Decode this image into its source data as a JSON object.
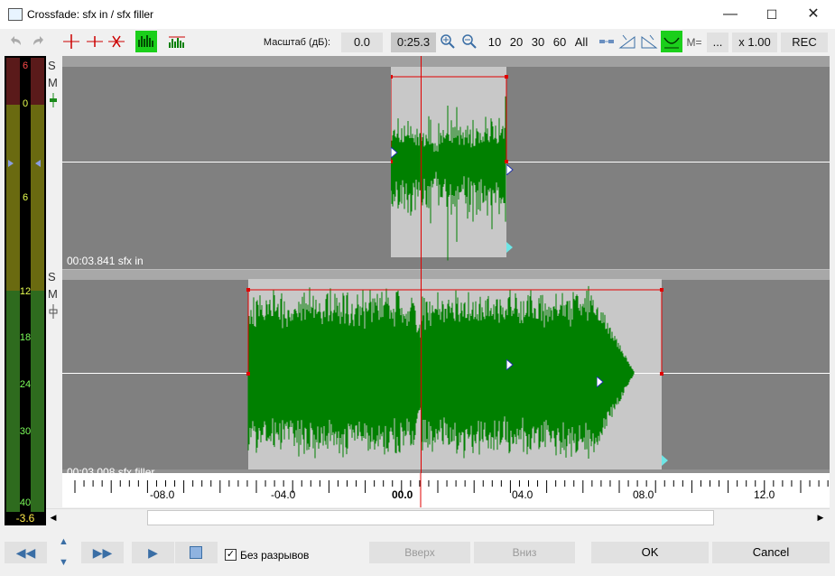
{
  "window": {
    "title": "Crossfade: sfx in / sfx filler",
    "minimize": "—",
    "maximize": "☐",
    "close": "✕"
  },
  "toolbar": {
    "scale_label": "Масштаб (дБ):",
    "scale_value": "0.0",
    "time_value": "0:25.3",
    "zoom_10": "10",
    "zoom_20": "20",
    "zoom_30": "30",
    "zoom_60": "60",
    "zoom_all": "All",
    "m_label": "M=",
    "dots": "...",
    "multiplier": "x 1.00",
    "rec": "REC"
  },
  "meter": {
    "labels": [
      "6",
      "0",
      "6",
      "12",
      "18",
      "24",
      "30",
      "40"
    ],
    "readout": "-3.6"
  },
  "track1": {
    "solo": "S",
    "mute": "M",
    "info": "00:03.841 sfx in"
  },
  "track2": {
    "solo": "S",
    "mute": "M",
    "info": "00:03.008 sfx filler"
  },
  "ruler": {
    "ticks": [
      "-08.0",
      "-04.0",
      "00.0",
      "04.0",
      "08.0",
      "12.0"
    ]
  },
  "bottom": {
    "seamless_label": "Без разрывов",
    "seamless_checked": true,
    "up_label": "Вверх",
    "down_label": "Вниз",
    "ok_label": "OK",
    "cancel_label": "Cancel"
  },
  "colors": {
    "waveform": "#008000",
    "accent_green": "#1bcf1b",
    "selection": "#c8c8c8",
    "edit_line": "#e00000"
  }
}
